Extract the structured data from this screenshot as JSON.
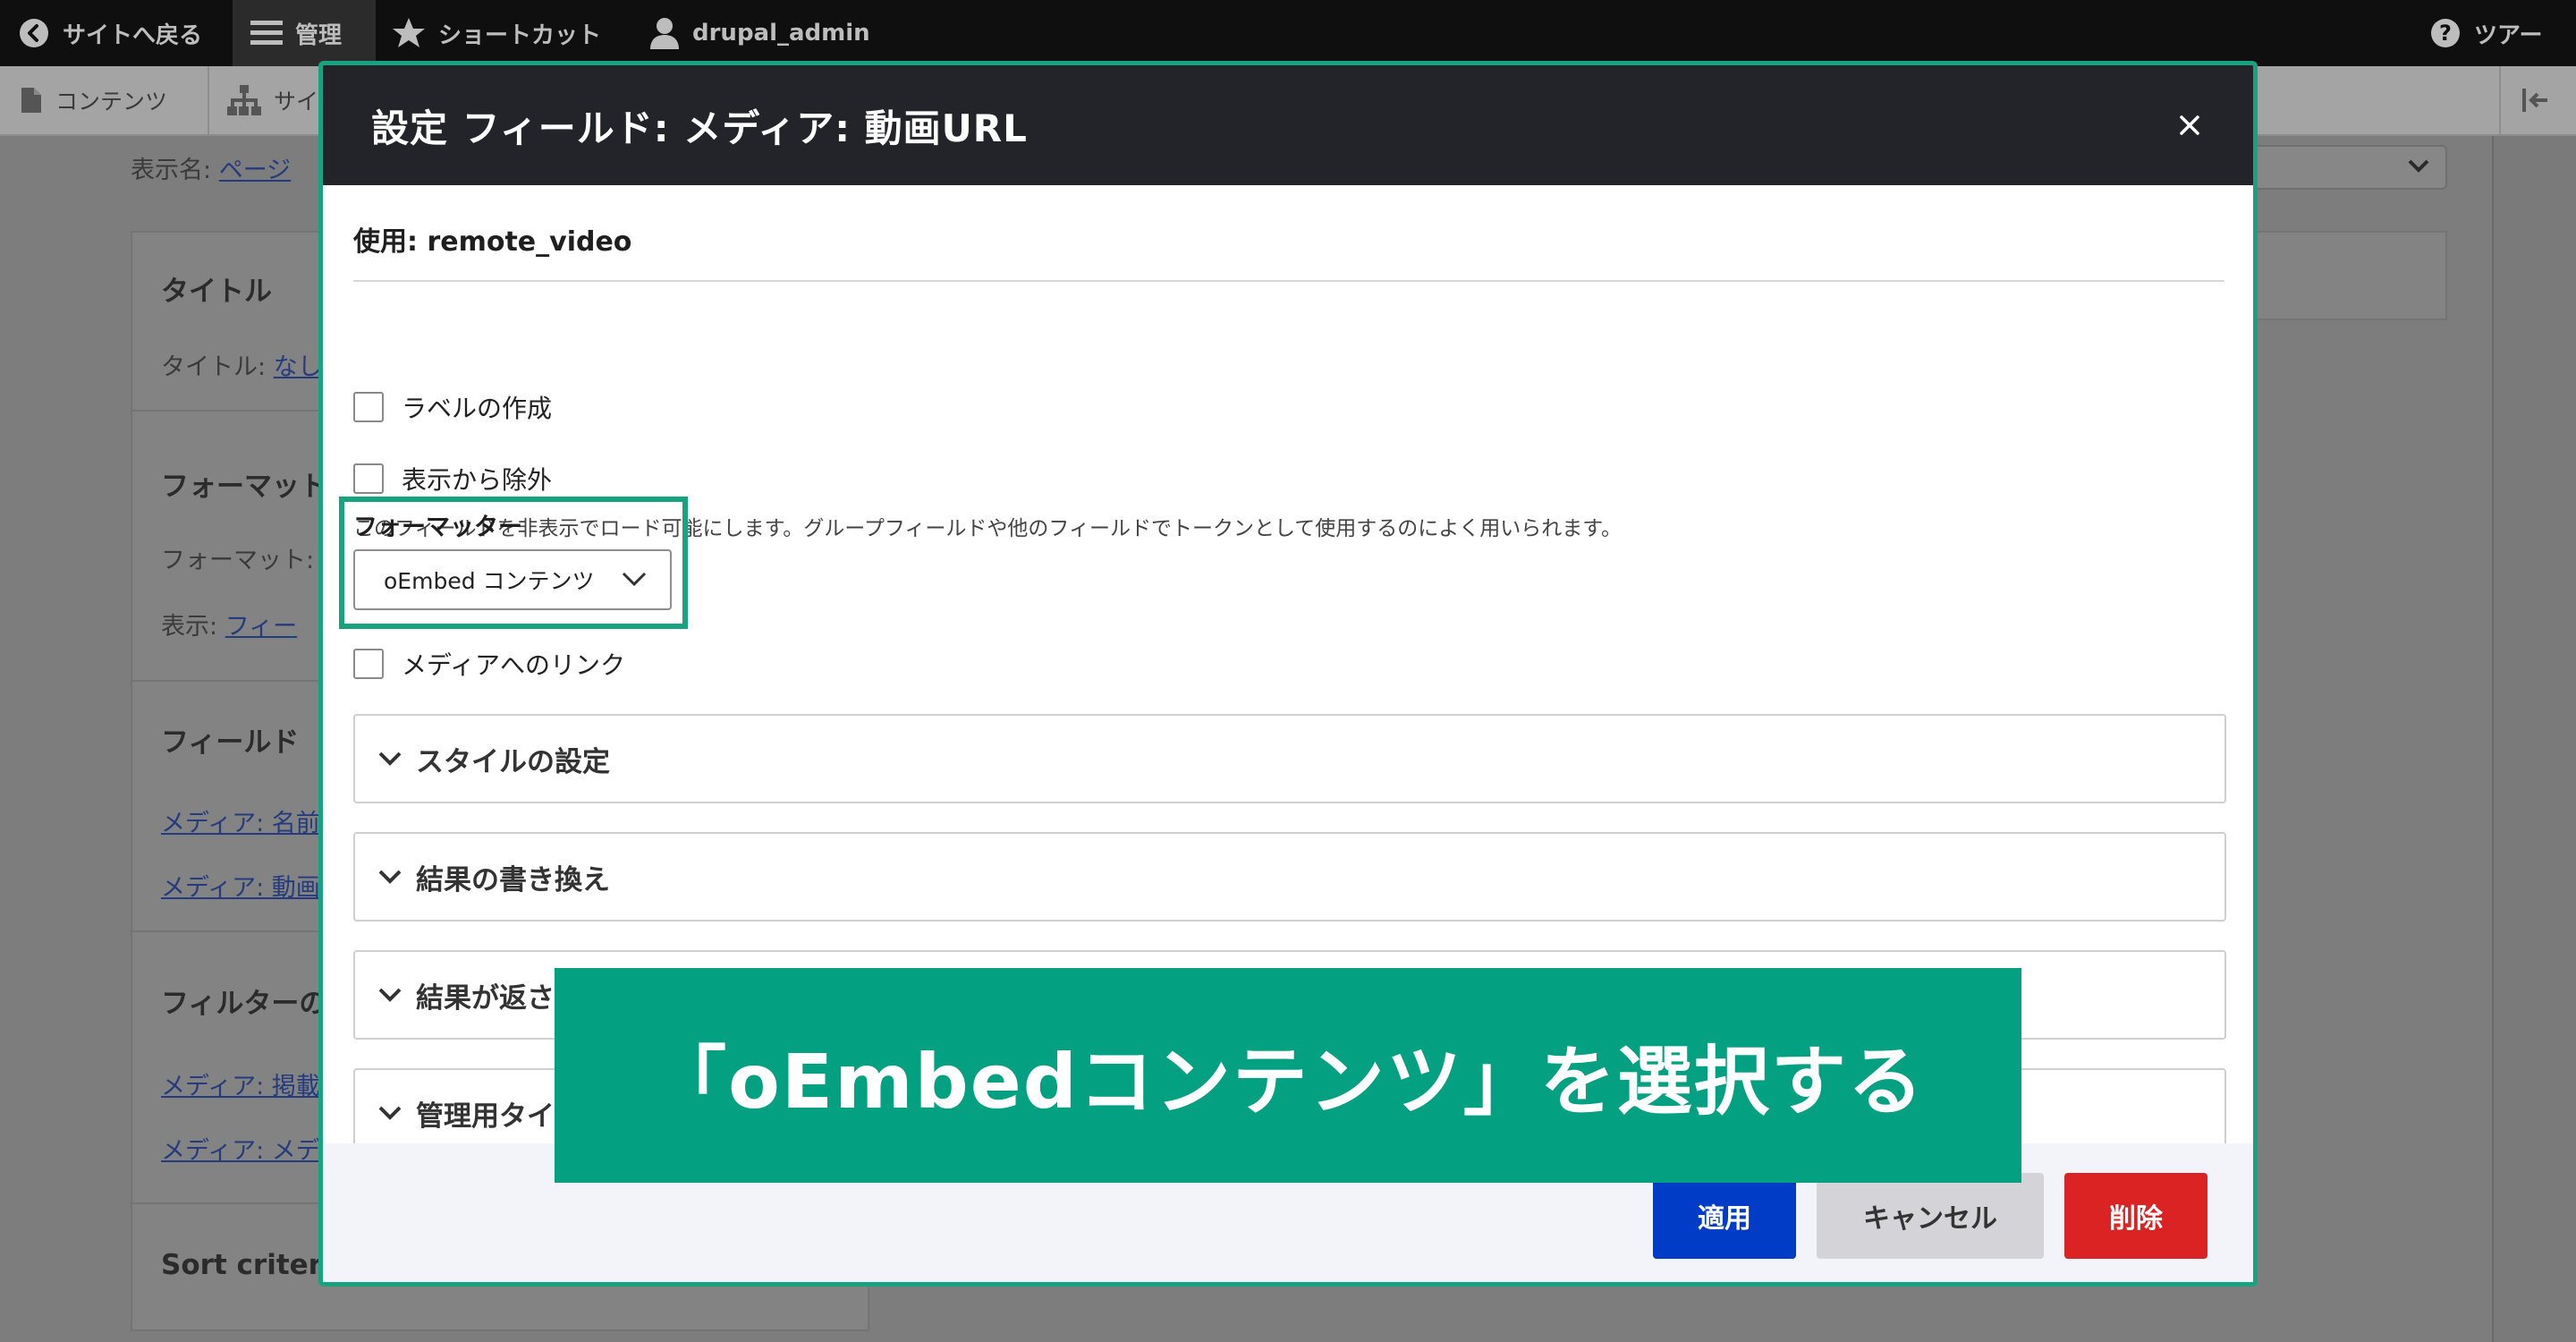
{
  "toolbar": {
    "back": "サイトへ戻る",
    "manage": "管理",
    "shortcuts": "ショートカット",
    "user": "drupal_admin",
    "tour": "ツアー"
  },
  "subbar": {
    "content": "コンテンツ",
    "structure": "サイ"
  },
  "background": {
    "display_name_label": "表示名:",
    "display_name_link": "ページ",
    "title_heading": "タイトル",
    "title_label": "タイトル:",
    "title_link": "なし",
    "format_heading": "フォーマット",
    "format_label": "フォーマット:",
    "show_label": "表示:",
    "show_link": "フィー",
    "fields_heading": "フィールド",
    "field_1": "メディア: 名前",
    "field_2": "メディア: 動画",
    "filters_heading": "フィルターの",
    "filter_1": "メディア: 掲載",
    "filter_2": "メディア: メデ",
    "sort_heading": "Sort criteria"
  },
  "modal": {
    "title": "設定 フィールド: メディア: 動画URL",
    "use_label": "使用: remote_video",
    "create_label": "ラベルの作成",
    "exclude": "表示から除外",
    "exclude_desc": "このフィールドを非表示でロード可能にします。グループフィールドや他のフィールドでトークンとして使用するのによく用いられます。",
    "formatter_label": "フォーマッター",
    "formatter_value": "oEmbed コンテンツ",
    "link_to_media": "メディアへのリンク",
    "accordions": [
      "スタイルの設定",
      "結果の書き換え",
      "結果が返さ",
      "管理用タイ"
    ],
    "apply": "適用",
    "cancel": "キャンセル",
    "delete": "削除"
  },
  "callout": {
    "text": "「oEmbedコンテンツ」を選択する"
  },
  "colors": {
    "accent_green": "#03a081",
    "primary_blue": "#003cc5",
    "danger_red": "#dc2323",
    "header_dark": "#232429"
  }
}
